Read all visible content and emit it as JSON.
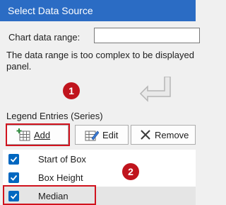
{
  "window": {
    "title": "Select Data Source"
  },
  "range": {
    "label": "Chart data range:"
  },
  "message": {
    "line1": "The data range is too complex to be displayed",
    "line2": "panel."
  },
  "callouts": [
    "1",
    "2"
  ],
  "legend": {
    "label": "Legend Entries (Series)",
    "add_label": "Add",
    "edit_label": "Edit",
    "remove_label": "Remove",
    "series": [
      {
        "name": "Start of Box",
        "checked": true
      },
      {
        "name": "Box Height",
        "checked": true
      },
      {
        "name": "Median",
        "checked": true
      }
    ]
  },
  "colors": {
    "titlebar": "#2b6cc4",
    "accent": "#0067c0",
    "callout": "#c0141d",
    "highlight": "#d1131e"
  }
}
